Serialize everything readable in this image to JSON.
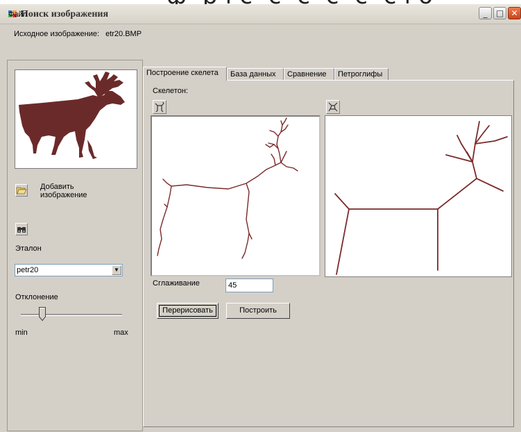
{
  "window": {
    "title": "Поиск изображения",
    "title_fragment": "фрагмент заголовка"
  },
  "menu": {
    "file": "Файл"
  },
  "source": {
    "label": "Исходное изображение:",
    "filename": "etr20.BMP"
  },
  "left": {
    "add_image_label": "Добавить изображение",
    "etalon_label": "Эталон",
    "etalon_value": "petr20",
    "deviation_label": "Отклонение",
    "slider_min": "min",
    "slider_max": "max",
    "deviation_level": 0.18
  },
  "tabs": [
    {
      "label": "Построение скелета",
      "active": true
    },
    {
      "label": "База данных",
      "active": false
    },
    {
      "label": "Сравнение",
      "active": false
    },
    {
      "label": "Петроглифы",
      "active": false
    }
  ],
  "skeleton_page": {
    "skeleton_label": "Скелетон:",
    "smoothing_label": "Сглаживание",
    "smoothing_value": "45",
    "redraw_button": "Перерисовать",
    "build_button": "Построить"
  },
  "colors": {
    "skeleton": "#7a2a2a",
    "silhouette": "#6b2a2a",
    "window_bg": "#d4d0c8"
  },
  "icons": {
    "open": "folder-open-icon",
    "find": "binoculars-icon",
    "skeleton1": "skeleton-shape-icon",
    "skeleton2": "skeleton-star-icon"
  }
}
